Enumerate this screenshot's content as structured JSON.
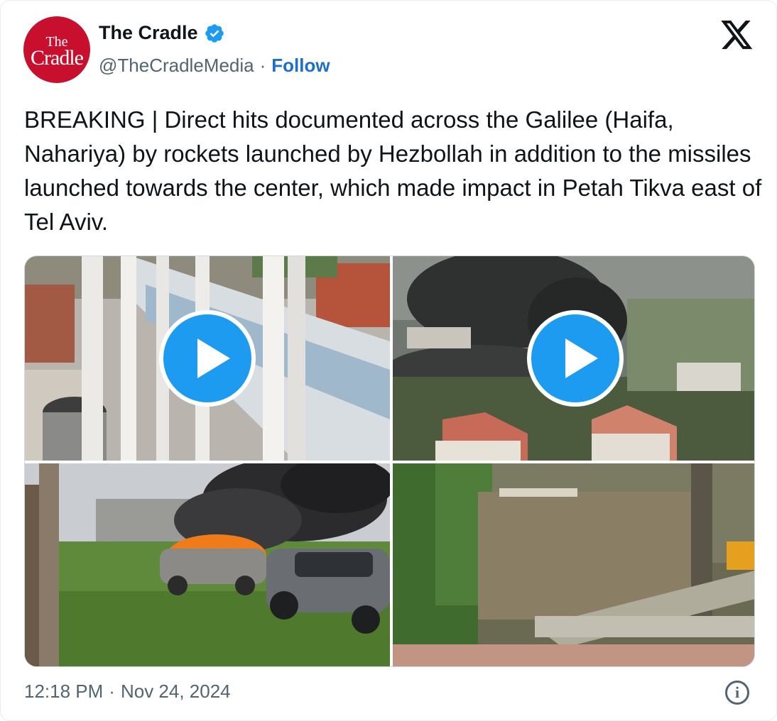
{
  "author": {
    "display_name": "The Cradle",
    "handle": "@TheCradleMedia",
    "separator": "·",
    "follow_label": "Follow",
    "avatar_text_top": "The",
    "avatar_text_main": "Cradle",
    "verified": true
  },
  "tweet": {
    "text": "BREAKING | Direct hits documented across the Galilee (Haifa, Nahariya) by rockets launched by Hezbollah in addition to the missiles launched towards the center, which made impact in Petah Tikva east of Tel Aviv."
  },
  "media": [
    {
      "kind": "video",
      "icon": "play-icon"
    },
    {
      "kind": "video",
      "icon": "play-icon"
    },
    {
      "kind": "image"
    },
    {
      "kind": "image"
    }
  ],
  "footer": {
    "time": "12:18 PM",
    "separator": "·",
    "date": "Nov 24, 2024",
    "info_icon": "info-icon"
  },
  "colors": {
    "accent": "#1d9bf0",
    "follow": "#1d70c9",
    "avatar_bg": "#c8102e",
    "muted_text": "#536471"
  }
}
